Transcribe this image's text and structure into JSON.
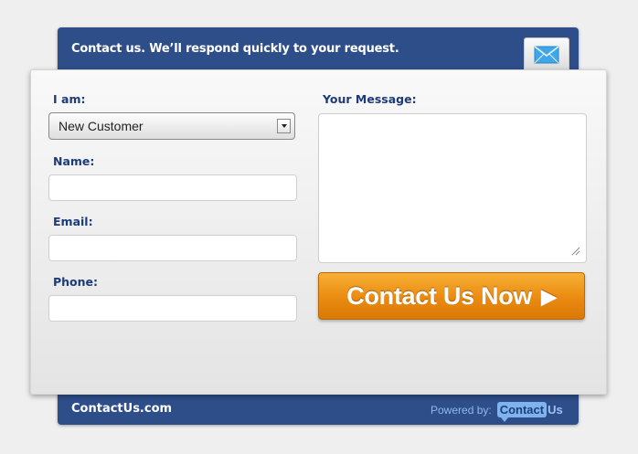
{
  "header": {
    "title": "Contact us. We’ll respond quickly to your request.",
    "mail_icon": "envelope-icon"
  },
  "form": {
    "i_am_label": "I am:",
    "i_am_value": "New Customer",
    "name_label": "Name:",
    "email_label": "Email:",
    "phone_label": "Phone:",
    "message_label": "Your Message:",
    "submit_label": "Contact Us Now",
    "submit_arrow": "▶"
  },
  "footer": {
    "site": "ContactUs.com",
    "powered_by": "Powered by:",
    "logo_contact": "Contact",
    "logo_us": "Us"
  },
  "colors": {
    "brand_blue": "#2e4e8a",
    "label_blue": "#1d3a7a",
    "button_orange": "#eb8a10"
  }
}
